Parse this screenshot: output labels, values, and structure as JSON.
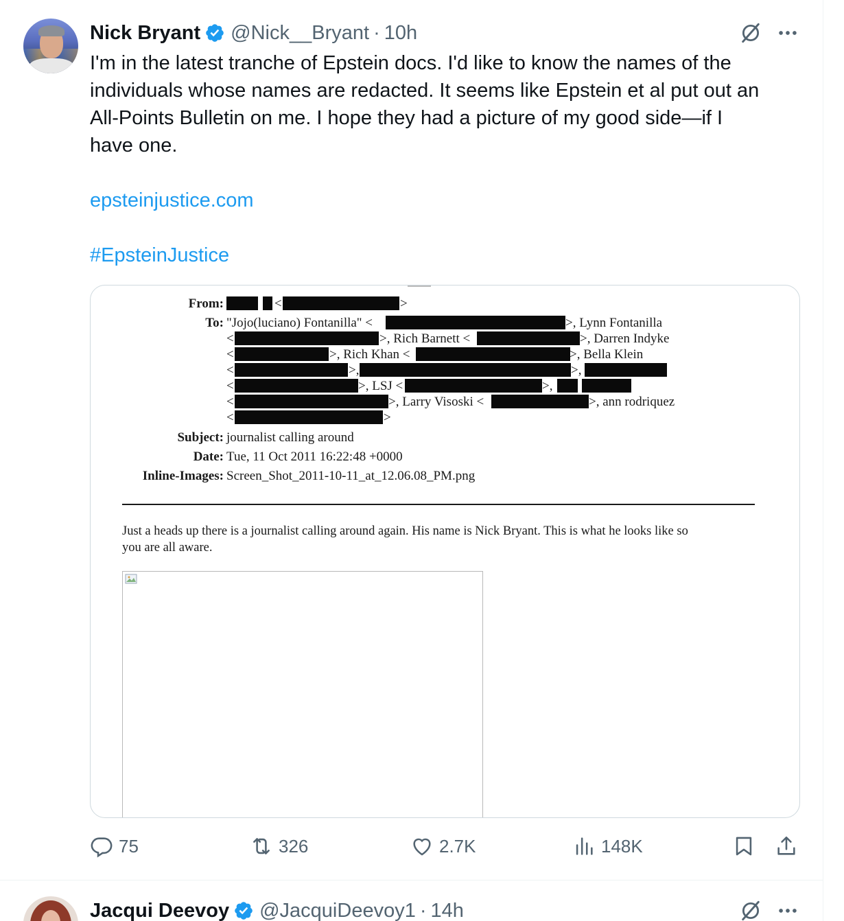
{
  "tweet1": {
    "author_name": "Nick Bryant",
    "handle": "@Nick__Bryant",
    "separator": "·",
    "time": "10h",
    "text_lines": [
      "I'm in the latest tranche of Epstein docs. I'd like to know the names of the",
      "individuals whose names are redacted. It seems like Epstein et al put out an",
      "All-Points Bulletin on me.  I hope they had a picture of my good side—if I",
      "have one."
    ],
    "link": "epsteinjustice.com",
    "hashtag": "#EpsteinJustice",
    "document": {
      "from_label": "From:",
      "to_label": "To:",
      "to_first": "\"Jojo(luciano) Fontanilla\" <",
      "name_lynn": ">, Lynn Fontanilla",
      "name_rich_barnett": ">, Rich Barnett <",
      "name_darren": ">, Darren Indyke",
      "name_rich_khan": ">, Rich Khan <",
      "name_bella": ">, Bella Klein",
      "name_lsj": ">, LSJ <",
      "name_larry": ">, Larry Visoski <",
      "name_ann": ">, ann rodriquez",
      "subject_label": "Subject:",
      "subject": "journalist calling around",
      "date_label": "Date:",
      "date": "Tue, 11 Oct 2011 16:22:48 +0000",
      "inline_label": "Inline-Images:",
      "inline": "Screen_Shot_2011-10-11_at_12.06.08_PM.png",
      "body_line1": "Just a heads up there is a journalist calling around again. His name is Nick Bryant. This is what he looks like so",
      "body_line2": "you are all aware."
    },
    "metrics": {
      "replies": "75",
      "reposts": "326",
      "likes": "2.7K",
      "views": "148K"
    }
  },
  "tweet2": {
    "author_name": "Jacqui Deevoy",
    "handle": "@JacquiDeevoy1",
    "separator": "·",
    "time": "14h"
  },
  "colors": {
    "verified": "#1d9bf0",
    "link": "#1d9bf0",
    "secondary_text": "#536471"
  },
  "icons": [
    "verified-badge-icon",
    "grok-icon",
    "more-icon",
    "reply-icon",
    "repost-icon",
    "like-icon",
    "views-icon",
    "bookmark-icon",
    "share-icon",
    "broken-image-icon"
  ]
}
